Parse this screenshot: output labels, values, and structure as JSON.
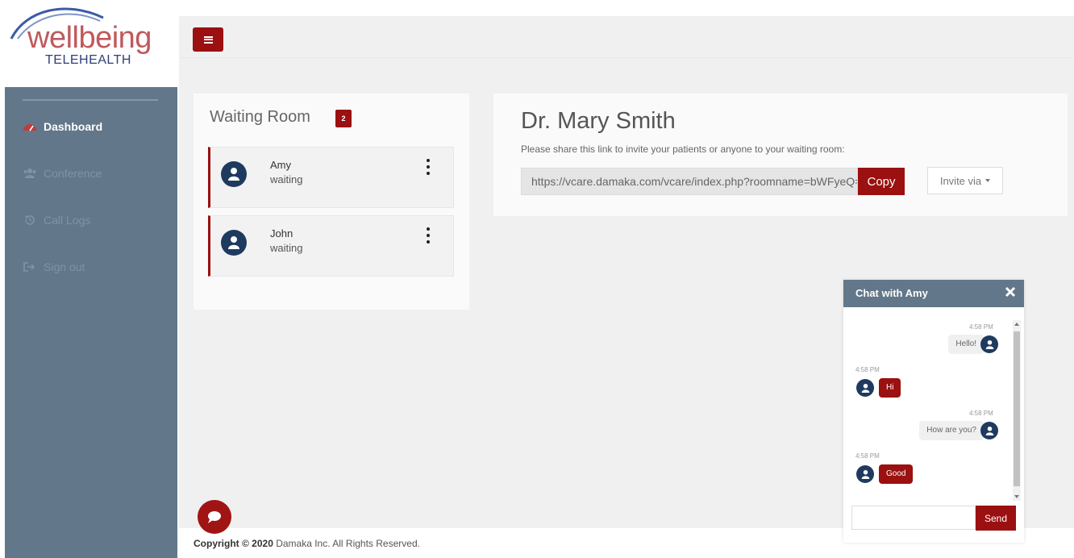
{
  "brand": {
    "name": "wellbeing",
    "tagline": "TELEHEALTH",
    "primary_color": "#9b1010",
    "sidebar_color": "#627789"
  },
  "sidebar": {
    "items": [
      {
        "label": "Dashboard",
        "icon": "dashboard-icon",
        "active": true
      },
      {
        "label": "Conference",
        "icon": "users-icon",
        "active": false
      },
      {
        "label": "Call Logs",
        "icon": "history-icon",
        "active": false
      },
      {
        "label": "Sign out",
        "icon": "sign-out-icon",
        "active": false
      }
    ]
  },
  "waiting_room": {
    "title": "Waiting Room",
    "count": "2",
    "patients": [
      {
        "name": "Amy",
        "status": "waiting"
      },
      {
        "name": "John",
        "status": "waiting"
      }
    ]
  },
  "doctor": {
    "name": "Dr. Mary Smith",
    "share_hint": "Please share this link to invite your patients or anyone to your waiting room:",
    "link": "https://vcare.damaka.com/vcare/index.php?roomname=bWFyeQ==",
    "copy_label": "Copy",
    "invite_label": "Invite via"
  },
  "chat": {
    "title": "Chat with Amy",
    "messages": [
      {
        "time": "4:58 PM",
        "text": "Hello!",
        "from": "me"
      },
      {
        "time": "4:58 PM",
        "text": "Hi",
        "from": "them"
      },
      {
        "time": "4:58 PM",
        "text": "How are you?",
        "from": "me"
      },
      {
        "time": "4:58 PM",
        "text": "Good",
        "from": "them"
      }
    ],
    "input_value": "",
    "send_label": "Send"
  },
  "footer": {
    "copyright_bold": "Copyright © 2020",
    "copyright_rest": " Damaka Inc. All Rights Reserved."
  }
}
